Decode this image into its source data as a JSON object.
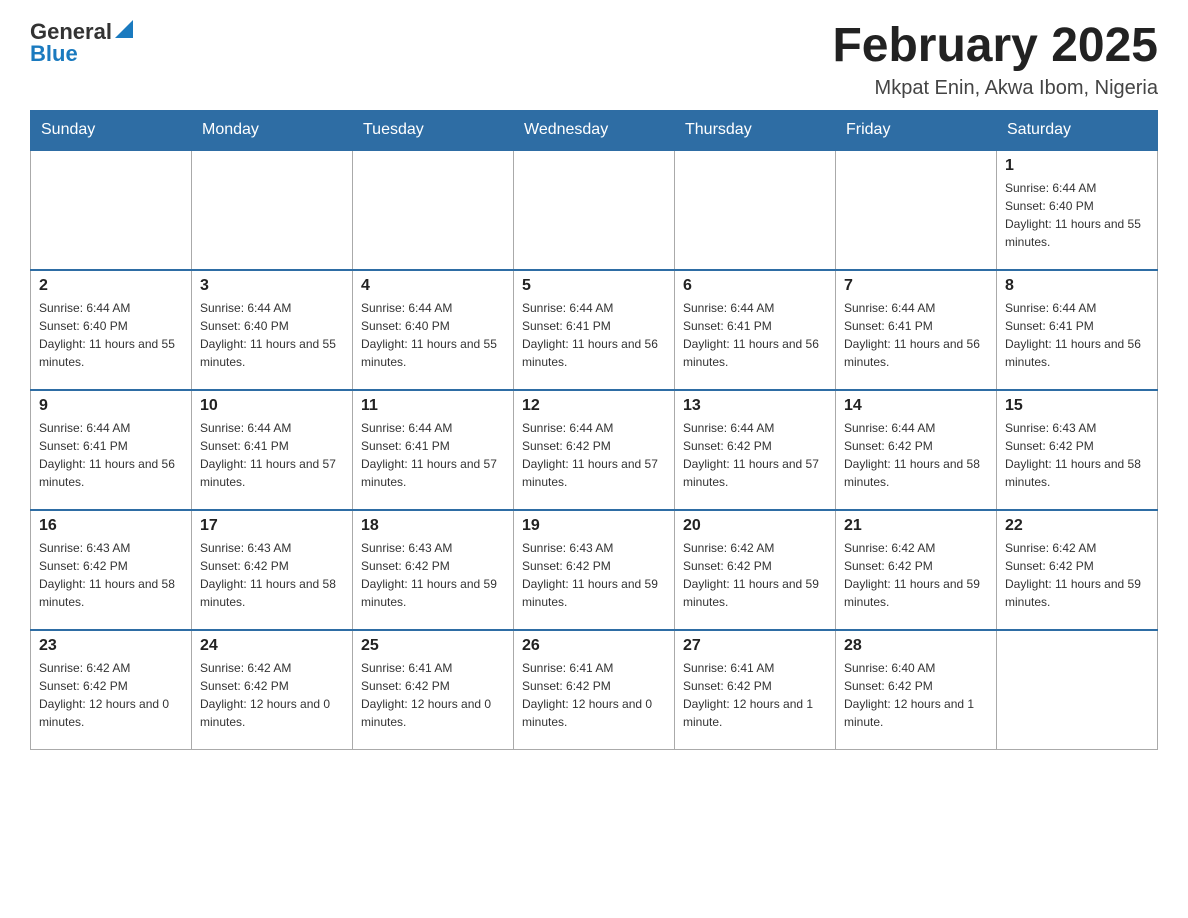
{
  "header": {
    "logo_general": "General",
    "logo_blue": "Blue",
    "month_title": "February 2025",
    "location": "Mkpat Enin, Akwa Ibom, Nigeria"
  },
  "weekdays": [
    "Sunday",
    "Monday",
    "Tuesday",
    "Wednesday",
    "Thursday",
    "Friday",
    "Saturday"
  ],
  "weeks": [
    [
      {
        "day": "",
        "info": ""
      },
      {
        "day": "",
        "info": ""
      },
      {
        "day": "",
        "info": ""
      },
      {
        "day": "",
        "info": ""
      },
      {
        "day": "",
        "info": ""
      },
      {
        "day": "",
        "info": ""
      },
      {
        "day": "1",
        "info": "Sunrise: 6:44 AM\nSunset: 6:40 PM\nDaylight: 11 hours and 55 minutes."
      }
    ],
    [
      {
        "day": "2",
        "info": "Sunrise: 6:44 AM\nSunset: 6:40 PM\nDaylight: 11 hours and 55 minutes."
      },
      {
        "day": "3",
        "info": "Sunrise: 6:44 AM\nSunset: 6:40 PM\nDaylight: 11 hours and 55 minutes."
      },
      {
        "day": "4",
        "info": "Sunrise: 6:44 AM\nSunset: 6:40 PM\nDaylight: 11 hours and 55 minutes."
      },
      {
        "day": "5",
        "info": "Sunrise: 6:44 AM\nSunset: 6:41 PM\nDaylight: 11 hours and 56 minutes."
      },
      {
        "day": "6",
        "info": "Sunrise: 6:44 AM\nSunset: 6:41 PM\nDaylight: 11 hours and 56 minutes."
      },
      {
        "day": "7",
        "info": "Sunrise: 6:44 AM\nSunset: 6:41 PM\nDaylight: 11 hours and 56 minutes."
      },
      {
        "day": "8",
        "info": "Sunrise: 6:44 AM\nSunset: 6:41 PM\nDaylight: 11 hours and 56 minutes."
      }
    ],
    [
      {
        "day": "9",
        "info": "Sunrise: 6:44 AM\nSunset: 6:41 PM\nDaylight: 11 hours and 56 minutes."
      },
      {
        "day": "10",
        "info": "Sunrise: 6:44 AM\nSunset: 6:41 PM\nDaylight: 11 hours and 57 minutes."
      },
      {
        "day": "11",
        "info": "Sunrise: 6:44 AM\nSunset: 6:41 PM\nDaylight: 11 hours and 57 minutes."
      },
      {
        "day": "12",
        "info": "Sunrise: 6:44 AM\nSunset: 6:42 PM\nDaylight: 11 hours and 57 minutes."
      },
      {
        "day": "13",
        "info": "Sunrise: 6:44 AM\nSunset: 6:42 PM\nDaylight: 11 hours and 57 minutes."
      },
      {
        "day": "14",
        "info": "Sunrise: 6:44 AM\nSunset: 6:42 PM\nDaylight: 11 hours and 58 minutes."
      },
      {
        "day": "15",
        "info": "Sunrise: 6:43 AM\nSunset: 6:42 PM\nDaylight: 11 hours and 58 minutes."
      }
    ],
    [
      {
        "day": "16",
        "info": "Sunrise: 6:43 AM\nSunset: 6:42 PM\nDaylight: 11 hours and 58 minutes."
      },
      {
        "day": "17",
        "info": "Sunrise: 6:43 AM\nSunset: 6:42 PM\nDaylight: 11 hours and 58 minutes."
      },
      {
        "day": "18",
        "info": "Sunrise: 6:43 AM\nSunset: 6:42 PM\nDaylight: 11 hours and 59 minutes."
      },
      {
        "day": "19",
        "info": "Sunrise: 6:43 AM\nSunset: 6:42 PM\nDaylight: 11 hours and 59 minutes."
      },
      {
        "day": "20",
        "info": "Sunrise: 6:42 AM\nSunset: 6:42 PM\nDaylight: 11 hours and 59 minutes."
      },
      {
        "day": "21",
        "info": "Sunrise: 6:42 AM\nSunset: 6:42 PM\nDaylight: 11 hours and 59 minutes."
      },
      {
        "day": "22",
        "info": "Sunrise: 6:42 AM\nSunset: 6:42 PM\nDaylight: 11 hours and 59 minutes."
      }
    ],
    [
      {
        "day": "23",
        "info": "Sunrise: 6:42 AM\nSunset: 6:42 PM\nDaylight: 12 hours and 0 minutes."
      },
      {
        "day": "24",
        "info": "Sunrise: 6:42 AM\nSunset: 6:42 PM\nDaylight: 12 hours and 0 minutes."
      },
      {
        "day": "25",
        "info": "Sunrise: 6:41 AM\nSunset: 6:42 PM\nDaylight: 12 hours and 0 minutes."
      },
      {
        "day": "26",
        "info": "Sunrise: 6:41 AM\nSunset: 6:42 PM\nDaylight: 12 hours and 0 minutes."
      },
      {
        "day": "27",
        "info": "Sunrise: 6:41 AM\nSunset: 6:42 PM\nDaylight: 12 hours and 1 minute."
      },
      {
        "day": "28",
        "info": "Sunrise: 6:40 AM\nSunset: 6:42 PM\nDaylight: 12 hours and 1 minute."
      },
      {
        "day": "",
        "info": ""
      }
    ]
  ]
}
